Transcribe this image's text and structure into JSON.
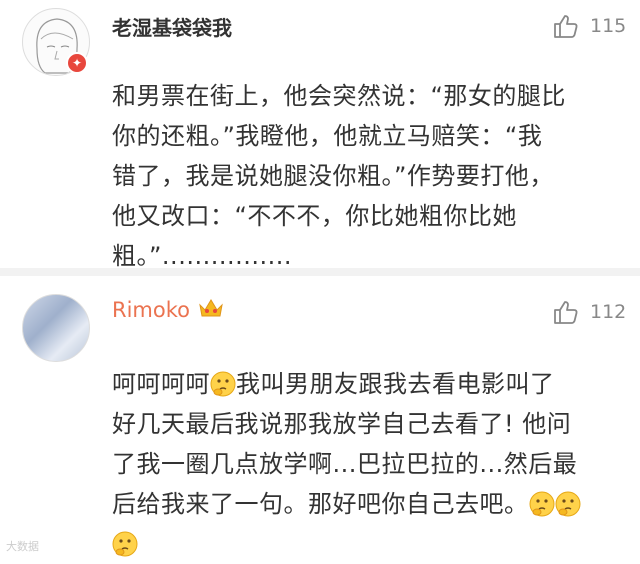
{
  "comments": [
    {
      "username": "老湿基袋袋我",
      "likes": "115",
      "lines": [
        "和男票在街上，他会突然说：“那女的腿比",
        "你的还粗。”我瞪他，他就立马赔笑：“我",
        "错了，我是说她腿没你粗。”作势要打他，",
        "他又改口：“不不不，你比她粗你比她",
        "粗。”................"
      ]
    },
    {
      "username": "Rimoko",
      "likes": "112",
      "line1_a": "呵呵呵呵",
      "line1_b": "我叫男朋友跟我去看电影叫了",
      "line2": "好几天最后我说那我放学自己去看了! 他问",
      "line3": "了我一圈几点放学啊...巴拉巴拉的...然后最",
      "line4": "后给我来了一句。那好吧你自己去吧。"
    }
  ],
  "watermark": "大数据",
  "colors": {
    "username_vip": "#eb7350",
    "text": "#333333",
    "like": "#888888",
    "divider": "#f2f2f2"
  },
  "icons": {
    "like": "thumbs-up-icon",
    "emoji": "thinking-emoji-icon",
    "crown": "crown-badge-icon",
    "vip": "vip-badge-icon"
  }
}
